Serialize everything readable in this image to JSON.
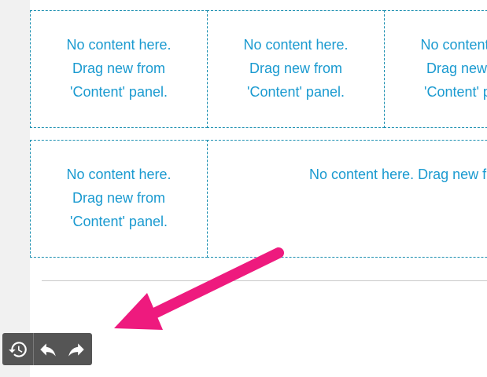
{
  "layout_grid": {
    "row1": [
      {
        "label": "No content here.\nDrag new from\n'Content' panel."
      },
      {
        "label": "No content here.\nDrag new from\n'Content' panel."
      },
      {
        "label": "No content here.\nDrag new from\n'Content' panel."
      }
    ],
    "row2": [
      {
        "label": "No content here.\nDrag new from\n'Content' panel."
      },
      {
        "label": "No content here. Drag new from 'Content' panel."
      }
    ]
  },
  "toolbar": {
    "history_icon": "history-icon",
    "undo_icon": "undo-icon",
    "redo_icon": "redo-icon"
  },
  "colors": {
    "placeholder_text": "#1a9ad0",
    "dashed_border": "#1b8fb0",
    "annotation_arrow": "#ee1a7e",
    "toolbar_bg": "#555555"
  }
}
